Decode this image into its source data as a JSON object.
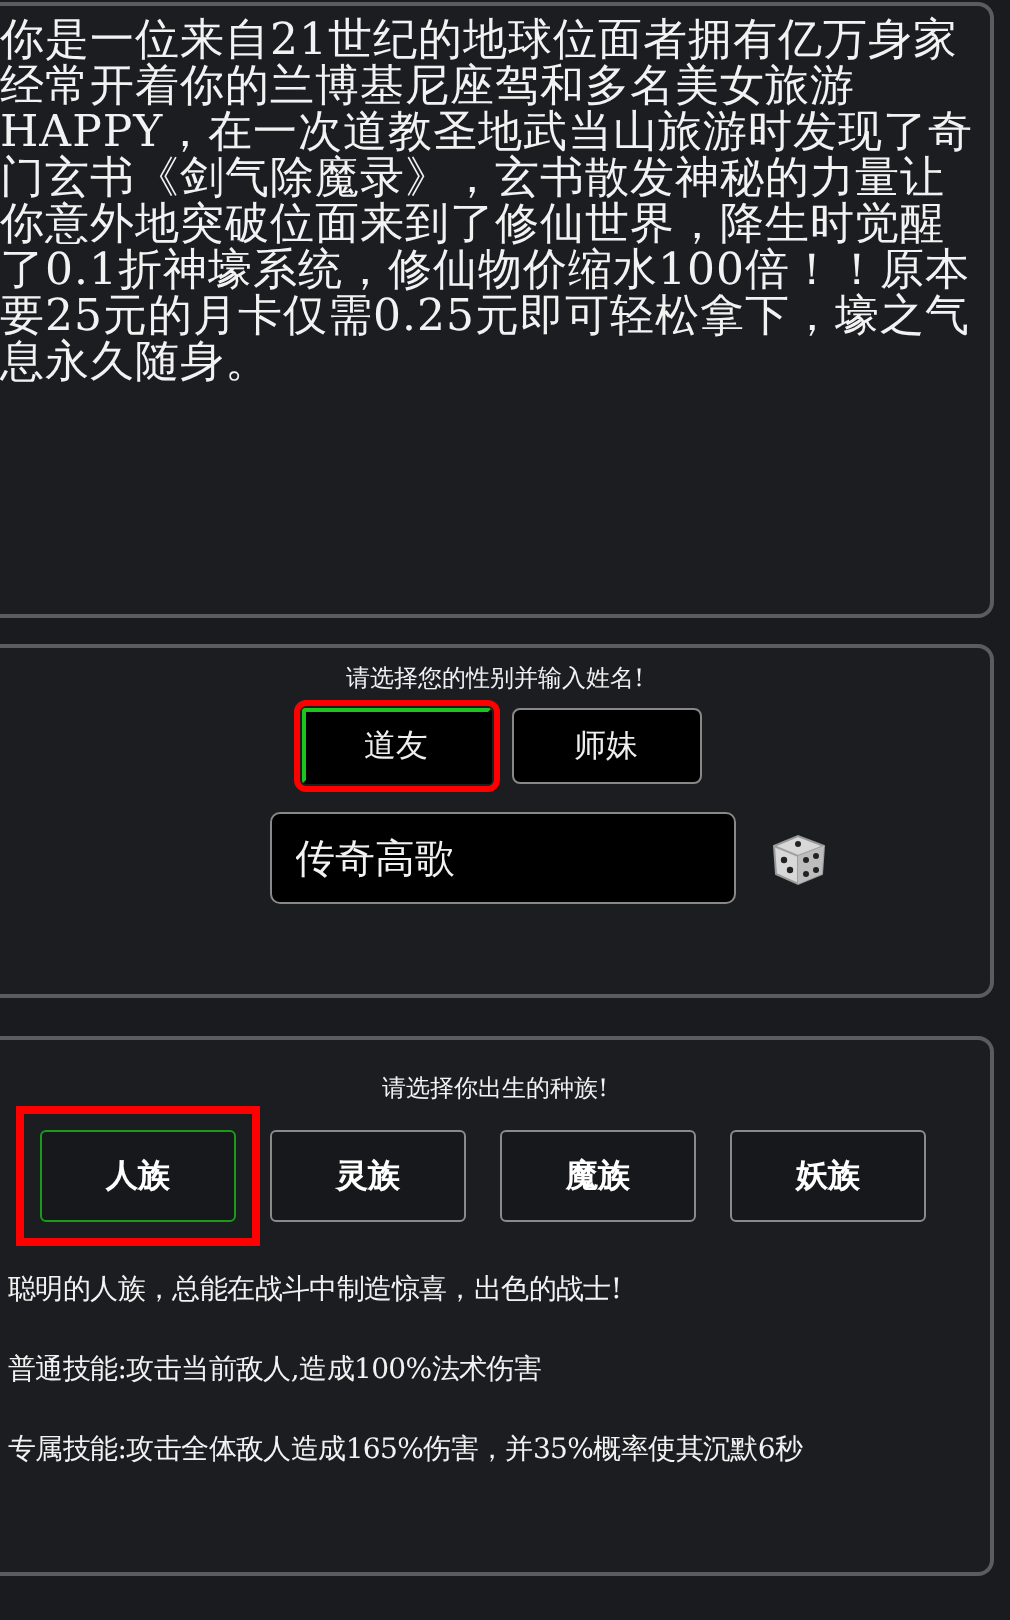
{
  "story": "你是一位来自21世纪的地球位面者拥有亿万身家经常开着你的兰博基尼座驾和多名美女旅游HAPPY，在一次道教圣地武当山旅游时发现了奇门玄书《剑气除魔录》，玄书散发神秘的力量让你意外地突破位面来到了修仙世界，降生时觉醒了0.1折神壕系统，修仙物价缩水100倍！！原本要25元的月卡仅需0.25元即可轻松拿下，壕之气息永久随身。",
  "gender": {
    "prompt": "请选择您的性别并输入姓名!",
    "options": [
      {
        "label": "道友",
        "selected": true
      },
      {
        "label": "师妹",
        "selected": false
      }
    ],
    "name_value": "传奇高歌"
  },
  "race": {
    "prompt": "请选择你出生的种族!",
    "options": [
      {
        "label": "人族",
        "selected": true
      },
      {
        "label": "灵族",
        "selected": false
      },
      {
        "label": "魔族",
        "selected": false
      },
      {
        "label": "妖族",
        "selected": false
      }
    ],
    "description": "聪明的人族，总能在战斗中制造惊喜，出色的战士!",
    "normal_skill": "普通技能:攻击当前敌人,造成100%法术伤害",
    "special_skill": "专属技能:攻击全体敌人造成165%伤害，并35%概率使其沉默6秒"
  }
}
